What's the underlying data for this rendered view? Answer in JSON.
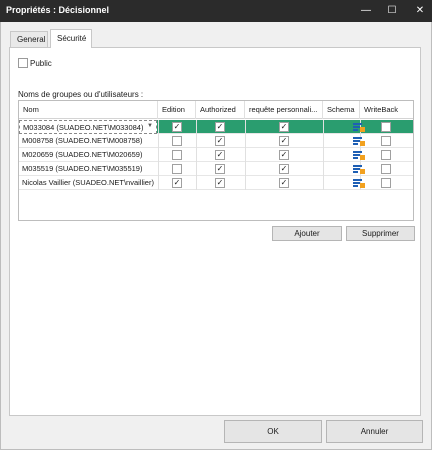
{
  "window": {
    "title": "Propriétés : Décisionnel",
    "min_glyph": "—",
    "max_glyph": "☐",
    "close_glyph": "✕"
  },
  "tabs": [
    {
      "label": "General"
    },
    {
      "label": "Sécurité"
    }
  ],
  "public": {
    "label": "Public",
    "checked": false
  },
  "groups_label": "Noms de groupes ou d'utilisateurs :",
  "table": {
    "columns": [
      "Nom",
      "Edition",
      "Authorized",
      "requête personnali...",
      "Schema",
      "WriteBack"
    ],
    "rows": [
      {
        "name": "M033084  (SUADEO.NET\\M033084)",
        "edition": true,
        "authorized": true,
        "requete": true,
        "schema": "schema-icon",
        "writeback": false,
        "selected": true
      },
      {
        "name": "M008758  (SUADEO.NET\\M008758)",
        "edition": false,
        "authorized": true,
        "requete": true,
        "schema": "schema-icon",
        "writeback": false,
        "selected": false
      },
      {
        "name": "M020659  (SUADEO.NET\\M020659)",
        "edition": false,
        "authorized": true,
        "requete": true,
        "schema": "schema-icon",
        "writeback": false,
        "selected": false
      },
      {
        "name": "M035519  (SUADEO.NET\\M035519)",
        "edition": false,
        "authorized": true,
        "requete": true,
        "schema": "schema-icon",
        "writeback": false,
        "selected": false
      },
      {
        "name": "Nicolas Vaillier (SUADEO.NET\\nvaillier)",
        "edition": true,
        "authorized": true,
        "requete": true,
        "schema": "schema-icon",
        "writeback": false,
        "selected": false
      }
    ]
  },
  "buttons": {
    "ajouter": "Ajouter",
    "supprimer": "Supprimer",
    "ok": "OK",
    "annuler": "Annuler"
  },
  "colors": {
    "title_bar": "#2b2b2b",
    "selection": "#2a9d6f",
    "schema_blue": "#1e5fb4",
    "schema_orange": "#f2a11f"
  }
}
